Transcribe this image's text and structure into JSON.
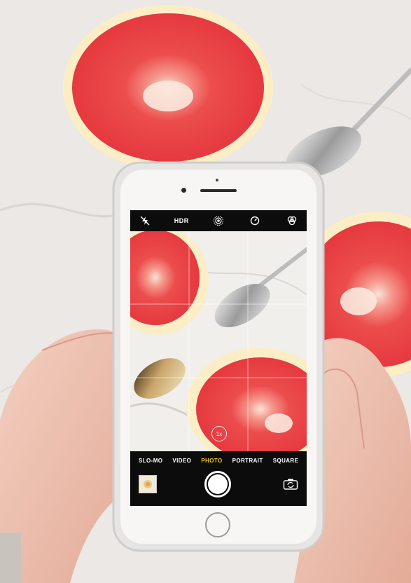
{
  "camera": {
    "hdr_label": "HDR",
    "zoom_label": "1x",
    "modes": [
      "SLO-MO",
      "VIDEO",
      "PHOTO",
      "PORTRAIT",
      "SQUARE"
    ],
    "active_mode": "PHOTO",
    "icons": {
      "flash": "flash-off-icon",
      "live": "live-photo-icon",
      "timer": "timer-icon",
      "filters": "filters-icon",
      "flip": "camera-flip-icon"
    },
    "accent_color": "#f7c600"
  }
}
